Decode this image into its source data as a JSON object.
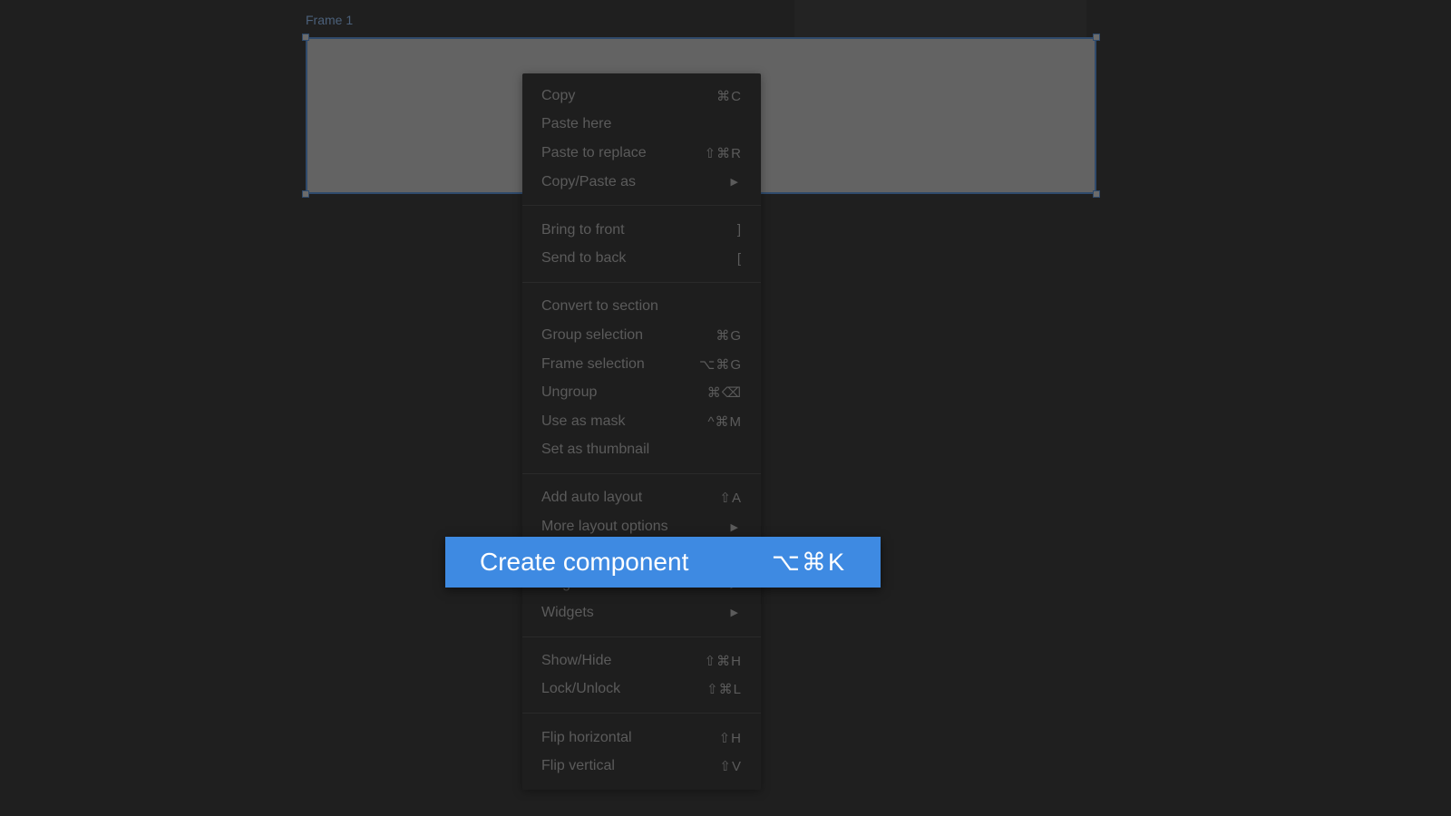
{
  "canvas": {
    "frame_label": "Frame 1",
    "frame_fill": "#636363",
    "selection_color": "#2f4a6b"
  },
  "menu": {
    "sections": [
      [
        {
          "label": "Copy",
          "shortcut": "⌘C"
        },
        {
          "label": "Paste here",
          "shortcut": ""
        },
        {
          "label": "Paste to replace",
          "shortcut": "⇧⌘R"
        },
        {
          "label": "Copy/Paste as",
          "submenu": true
        }
      ],
      [
        {
          "label": "Bring to front",
          "shortcut": "]"
        },
        {
          "label": "Send to back",
          "shortcut": "["
        }
      ],
      [
        {
          "label": "Convert to section",
          "shortcut": ""
        },
        {
          "label": "Group selection",
          "shortcut": "⌘G"
        },
        {
          "label": "Frame selection",
          "shortcut": "⌥⌘G"
        },
        {
          "label": "Ungroup",
          "shortcut": "⌘⌫"
        },
        {
          "label": "Use as mask",
          "shortcut": "^⌘M"
        },
        {
          "label": "Set as thumbnail",
          "shortcut": ""
        }
      ],
      [
        {
          "label": "Add auto layout",
          "shortcut": "⇧A"
        },
        {
          "label": "More layout options",
          "submenu": true
        },
        {
          "label": "Create component",
          "shortcut": "⌥⌘K"
        },
        {
          "label": "Plugins",
          "submenu": true
        },
        {
          "label": "Widgets",
          "submenu": true
        }
      ],
      [
        {
          "label": "Show/Hide",
          "shortcut": "⇧⌘H"
        },
        {
          "label": "Lock/Unlock",
          "shortcut": "⇧⌘L"
        }
      ],
      [
        {
          "label": "Flip horizontal",
          "shortcut": "⇧H"
        },
        {
          "label": "Flip vertical",
          "shortcut": "⇧V"
        }
      ]
    ]
  },
  "highlight": {
    "label": "Create component",
    "shortcut": "⌥⌘K",
    "color": "#3e8ae2"
  }
}
